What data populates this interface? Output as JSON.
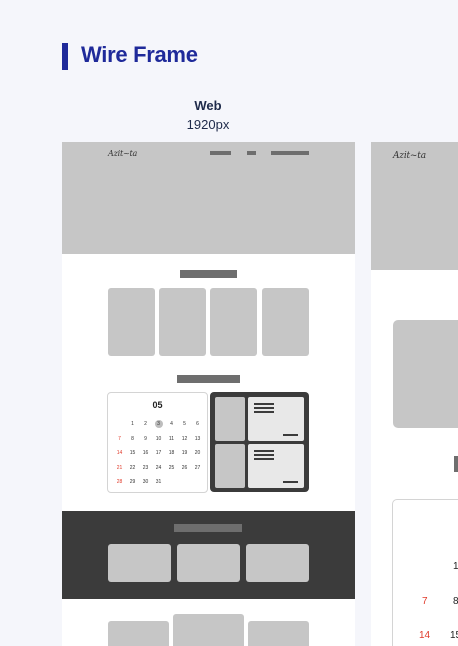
{
  "header": {
    "title": "Wire Frame",
    "accent_color": "#1f2a9a"
  },
  "web": {
    "label": "Web",
    "size": "1920px"
  },
  "mockup": {
    "logo_text": "Azit~ta",
    "calendar": {
      "month": "05",
      "days": [
        {
          "d": "1",
          "c": ""
        },
        {
          "d": "2",
          "c": ""
        },
        {
          "d": "3",
          "c": "sel"
        },
        {
          "d": "4",
          "c": ""
        },
        {
          "d": "5",
          "c": ""
        },
        {
          "d": "6",
          "c": ""
        },
        {
          "d": "7",
          "c": "red"
        },
        {
          "d": "8",
          "c": ""
        },
        {
          "d": "9",
          "c": ""
        },
        {
          "d": "10",
          "c": ""
        },
        {
          "d": "11",
          "c": ""
        },
        {
          "d": "12",
          "c": ""
        },
        {
          "d": "13",
          "c": ""
        },
        {
          "d": "14",
          "c": "red"
        },
        {
          "d": "15",
          "c": ""
        },
        {
          "d": "16",
          "c": ""
        },
        {
          "d": "17",
          "c": ""
        },
        {
          "d": "18",
          "c": ""
        },
        {
          "d": "19",
          "c": ""
        },
        {
          "d": "20",
          "c": ""
        },
        {
          "d": "21",
          "c": "red"
        },
        {
          "d": "22",
          "c": ""
        },
        {
          "d": "23",
          "c": ""
        },
        {
          "d": "24",
          "c": ""
        },
        {
          "d": "25",
          "c": ""
        },
        {
          "d": "26",
          "c": ""
        },
        {
          "d": "27",
          "c": ""
        },
        {
          "d": "28",
          "c": "red"
        },
        {
          "d": "29",
          "c": ""
        },
        {
          "d": "30",
          "c": ""
        },
        {
          "d": "31",
          "c": ""
        }
      ],
      "first_day_offset": 1,
      "accent_color": "#e03a2a"
    }
  },
  "mockup_right": {
    "logo_text": "Azit~ta",
    "days_visible": [
      {
        "d": "1",
        "c": ""
      },
      {
        "d": "7",
        "c": "red"
      },
      {
        "d": "8",
        "c": ""
      },
      {
        "d": "14",
        "c": "red"
      },
      {
        "d": "15",
        "c": ""
      }
    ]
  }
}
